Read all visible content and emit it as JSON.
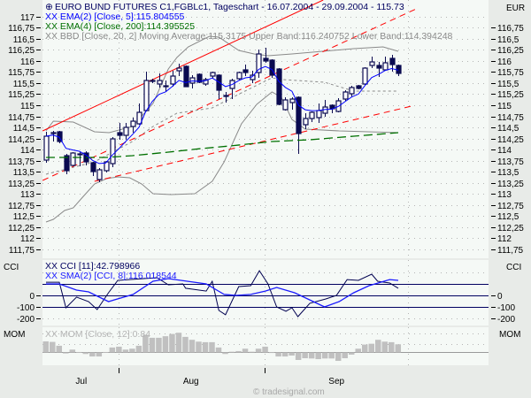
{
  "header": {
    "title": "EURO BUND FUTURES C1,FGBLc1, Tageschart - 16.07.2004 - 29.09.2004 - 115.73",
    "currency": "EUR",
    "legend": [
      {
        "text": "XX EMA(2) [Close, 5]:115.804555",
        "color": "#0000ff"
      },
      {
        "text": "XX EMA(4) [Close, 200]:114.395525",
        "color": "#007000"
      },
      {
        "text": "XX BBD [Close, 20, 2] Moving Average:115.3175 Upper Band:116.240752 Lower Band:114.394248",
        "color": "#8a8a8a"
      }
    ]
  },
  "cci_panel": {
    "label": "CCI",
    "legend": [
      {
        "text": "XX CCI [11]:42.798966",
        "color": "#000060"
      },
      {
        "text": "XX SMA(2) [CCI, 8]:116.018544",
        "color": "#1a1aff"
      }
    ]
  },
  "mom_panel": {
    "label": "MOM",
    "legend": {
      "text": "XX MOM [Close, 12]:0.84",
      "color": "#b4b4b4"
    }
  },
  "footer": {
    "copyright": "© tradesignal.com"
  },
  "colors": {
    "background": "#e8ebe8",
    "plot": "#f5f9f6",
    "candle": "#0a0a50",
    "ema5": "#0000ff",
    "ema200": "#007000",
    "bands": "#8a8a8a",
    "trend": "#ff0000",
    "mom": "#c0c0c0"
  },
  "chart_data": [
    {
      "type": "candlestick",
      "title": "EURO BUND FUTURES C1,FGBLc1, Tageschart - 16.07.2004 - 29.09.2004 - 115.73",
      "ylabel": "EUR",
      "ylim": [
        111.54,
        117.38
      ],
      "y_ticks_left": [
        "117",
        "116,75",
        "116,5",
        "116,25",
        "116",
        "115,75",
        "115,5",
        "115,25",
        "115",
        "114,75",
        "114,5",
        "114,25",
        "114",
        "113,75",
        "113,5",
        "113,25",
        "113",
        "112,75",
        "112,5",
        "112,25",
        "112",
        "111,75"
      ],
      "y_ticks_right": [
        "116,75",
        "116,5",
        "116,25",
        "116",
        "115,75",
        "115,5",
        "115,25",
        "115",
        "114,75",
        "114,5",
        "114,25",
        "114",
        "113,75",
        "113,5",
        "113,25",
        "113",
        "112,75",
        "112,5",
        "112,25",
        "112",
        "111,75"
      ],
      "x_labels": [
        {
          "label": "Jul",
          "index": 5.3
        },
        {
          "label": "Aug",
          "index": 21.8
        },
        {
          "label": "Sep",
          "index": 43.7
        }
      ],
      "month_boundaries": [
        10.9,
        32.9
      ],
      "ohlc": [
        [
          113.76,
          114.4,
          113.7,
          114.3
        ],
        [
          114.37,
          114.42,
          114.18,
          114.38
        ],
        [
          114.4,
          114.42,
          114.14,
          114.18
        ],
        [
          113.86,
          113.9,
          113.44,
          113.52
        ],
        [
          113.64,
          113.94,
          113.62,
          113.92
        ],
        [
          113.88,
          113.94,
          113.62,
          113.9
        ],
        [
          113.92,
          113.96,
          113.64,
          113.72
        ],
        [
          113.7,
          113.72,
          113.4,
          113.5
        ],
        [
          113.32,
          113.58,
          113.26,
          113.54
        ],
        [
          113.52,
          113.74,
          113.48,
          113.72
        ],
        [
          113.68,
          114.28,
          113.6,
          114.24
        ],
        [
          114.38,
          114.6,
          114.22,
          114.32
        ],
        [
          114.32,
          114.6,
          114.22,
          114.5
        ],
        [
          114.52,
          114.72,
          114.38,
          114.64
        ],
        [
          114.58,
          115.04,
          114.56,
          114.84
        ],
        [
          114.88,
          115.76,
          114.86,
          115.56
        ],
        [
          115.54,
          115.6,
          115.5,
          115.56
        ],
        [
          115.48,
          115.72,
          115.4,
          115.56
        ],
        [
          115.44,
          115.56,
          115.3,
          115.42
        ],
        [
          115.48,
          115.78,
          115.42,
          115.66
        ],
        [
          115.78,
          115.94,
          115.66,
          115.84
        ],
        [
          115.88,
          115.9,
          115.42,
          115.42
        ],
        [
          115.5,
          115.68,
          115.38,
          115.62
        ],
        [
          115.7,
          115.72,
          115.5,
          115.52
        ],
        [
          115.48,
          115.62,
          115.44,
          115.58
        ],
        [
          115.66,
          115.76,
          115.6,
          115.74
        ],
        [
          115.68,
          115.7,
          115.14,
          115.34
        ],
        [
          115.2,
          115.3,
          115.06,
          115.22
        ],
        [
          115.38,
          115.6,
          115.14,
          115.56
        ],
        [
          115.6,
          115.76,
          115.56,
          115.74
        ],
        [
          115.8,
          115.92,
          115.66,
          115.74
        ],
        [
          115.58,
          115.78,
          115.5,
          115.68
        ],
        [
          115.74,
          116.26,
          115.62,
          116.16
        ],
        [
          116.06,
          116.3,
          115.96,
          116.0
        ],
        [
          116.02,
          116.04,
          115.62,
          115.68
        ],
        [
          115.82,
          115.84,
          115.0,
          115.02
        ],
        [
          114.9,
          115.18,
          114.88,
          115.12
        ],
        [
          115.06,
          115.18,
          114.9,
          115.14
        ],
        [
          115.18,
          115.2,
          113.9,
          114.36
        ],
        [
          114.56,
          114.82,
          114.46,
          114.7
        ],
        [
          114.7,
          114.86,
          114.62,
          114.84
        ],
        [
          114.72,
          115.04,
          114.6,
          114.88
        ],
        [
          114.82,
          115.12,
          114.74,
          114.96
        ],
        [
          115.0,
          115.02,
          114.82,
          114.92
        ],
        [
          114.86,
          115.16,
          114.84,
          115.1
        ],
        [
          115.14,
          115.34,
          115.1,
          115.3
        ],
        [
          115.26,
          115.44,
          115.2,
          115.4
        ],
        [
          115.44,
          115.46,
          115.36,
          115.38
        ],
        [
          115.48,
          115.86,
          115.46,
          115.84
        ],
        [
          115.9,
          116.1,
          115.84,
          115.98
        ],
        [
          115.9,
          115.98,
          115.64,
          115.84
        ],
        [
          115.8,
          116.1,
          115.78,
          115.96
        ],
        [
          116.06,
          116.14,
          115.76,
          115.92
        ],
        [
          115.9,
          115.92,
          115.66,
          115.72
        ]
      ],
      "ema200": [
        [
          0,
          113.82
        ],
        [
          9,
          113.82
        ],
        [
          13,
          113.86
        ],
        [
          18.4,
          113.94
        ],
        [
          23.3,
          114.02
        ],
        [
          27.7,
          114.08
        ],
        [
          34,
          114.18
        ],
        [
          39.7,
          114.22
        ],
        [
          46.3,
          114.3
        ],
        [
          53,
          114.38
        ]
      ],
      "bb_upper": [
        [
          0,
          114.42
        ],
        [
          1.1,
          114.64
        ],
        [
          4.1,
          114.62
        ],
        [
          7.3,
          114.4
        ],
        [
          9.5,
          114.38
        ],
        [
          13,
          114.52
        ],
        [
          16.1,
          115.04
        ],
        [
          18.4,
          115.82
        ],
        [
          19.7,
          116.08
        ],
        [
          21.4,
          116.32
        ],
        [
          24.6,
          116.56
        ],
        [
          26,
          116.54
        ],
        [
          29,
          116.24
        ],
        [
          31.3,
          116.16
        ],
        [
          33.4,
          116.12
        ],
        [
          37,
          116.16
        ],
        [
          46.3,
          116.28
        ],
        [
          50.7,
          116.32
        ],
        [
          53,
          116.22
        ]
      ],
      "bb_middle": [
        [
          0,
          113.44
        ],
        [
          7.3,
          113.72
        ],
        [
          13,
          114.18
        ],
        [
          16.1,
          114.52
        ],
        [
          19.7,
          114.82
        ],
        [
          25,
          114.94
        ],
        [
          29.4,
          115.28
        ],
        [
          34,
          115.62
        ],
        [
          35.7,
          115.58
        ],
        [
          41.9,
          115.52
        ],
        [
          46.3,
          115.32
        ],
        [
          53,
          115.32
        ]
      ],
      "bb_lower": [
        [
          0,
          112.36
        ],
        [
          1.1,
          112.42
        ],
        [
          2.8,
          112.62
        ],
        [
          4.1,
          112.68
        ],
        [
          5.5,
          112.92
        ],
        [
          7.3,
          113.22
        ],
        [
          9.1,
          113.34
        ],
        [
          10.8,
          113.38
        ],
        [
          12.6,
          113.36
        ],
        [
          14.4,
          113.22
        ],
        [
          16.1,
          113.0
        ],
        [
          18.8,
          112.98
        ],
        [
          22.4,
          113.0
        ],
        [
          25,
          113.28
        ],
        [
          26.8,
          113.72
        ],
        [
          29.4,
          114.58
        ],
        [
          31.7,
          115.02
        ],
        [
          34,
          115.3
        ],
        [
          35.4,
          115.18
        ],
        [
          37,
          114.68
        ],
        [
          39,
          114.46
        ],
        [
          44.1,
          114.42
        ],
        [
          53,
          114.38
        ]
      ],
      "trendlines": [
        {
          "name": "upper-channel",
          "style": "solid",
          "points": [
            [
              -0.5,
              114.42
            ],
            [
              41.7,
              117.38
            ]
          ]
        },
        {
          "name": "middle-channel",
          "style": "dashed",
          "points": [
            [
              -0.5,
              113.3
            ],
            [
              55.7,
              117.18
            ]
          ]
        },
        {
          "name": "lower-channel",
          "style": "dashed",
          "points": [
            [
              7.3,
              113.28
            ],
            [
              55,
              114.98
            ]
          ]
        }
      ]
    },
    {
      "type": "line",
      "title": "CCI",
      "ylim": [
        -262,
        308
      ],
      "y_ticks": [
        "0",
        "-100",
        "-200"
      ],
      "levels": [
        100,
        0,
        -100
      ],
      "cci": [
        [
          0,
          115
        ],
        [
          2,
          115
        ],
        [
          3,
          -108
        ],
        [
          4.6,
          -15
        ],
        [
          6.4,
          -54
        ],
        [
          7.7,
          -123
        ],
        [
          9.4,
          23
        ],
        [
          10.8,
          131
        ],
        [
          16.7,
          154
        ],
        [
          18.4,
          92
        ],
        [
          20.6,
          100
        ],
        [
          21,
          62
        ],
        [
          24.1,
          38
        ],
        [
          25,
          123
        ],
        [
          26,
          -131
        ],
        [
          27,
          -169
        ],
        [
          29,
          77
        ],
        [
          30.8,
          85
        ],
        [
          32.1,
          215
        ],
        [
          33.4,
          100
        ],
        [
          34.7,
          -100
        ],
        [
          36.1,
          -138
        ],
        [
          37,
          -108
        ],
        [
          37.9,
          -185
        ],
        [
          39.7,
          -69
        ],
        [
          42.1,
          -31
        ],
        [
          43.7,
          0
        ],
        [
          45.3,
          138
        ],
        [
          47,
          131
        ],
        [
          49,
          185
        ],
        [
          49.9,
          123
        ],
        [
          51.7,
          108
        ],
        [
          53,
          62
        ]
      ],
      "sma": [
        [
          0,
          100
        ],
        [
          2,
          100
        ],
        [
          4.6,
          46
        ],
        [
          6.4,
          31
        ],
        [
          9.4,
          -54
        ],
        [
          13.1,
          8
        ],
        [
          16.1,
          123
        ],
        [
          18.4,
          146
        ],
        [
          24.1,
          100
        ],
        [
          26.8,
          8
        ],
        [
          28.6,
          0
        ],
        [
          30.8,
          8
        ],
        [
          33,
          38
        ],
        [
          34.7,
          69
        ],
        [
          37.4,
          23
        ],
        [
          41.9,
          -100
        ],
        [
          44.1,
          -54
        ],
        [
          46.3,
          23
        ],
        [
          48.6,
          85
        ],
        [
          51.7,
          138
        ],
        [
          53,
          131
        ]
      ]
    },
    {
      "type": "bar",
      "title": "MOM",
      "ylim": [
        -1.45,
        2.7
      ],
      "values": [
        1.16,
        1.1,
        0.68,
        -0.16,
        0.26,
        0,
        -0.22,
        -0.49,
        -0.49,
        0,
        0.49,
        0.58,
        0.26,
        0.36,
        0.68,
        1.87,
        1.55,
        1.55,
        1.72,
        1.97,
        2.1,
        1.65,
        1.33,
        1.13,
        1.07,
        1.07,
        0.49,
        -0.22,
        0.03,
        0.1,
        0.36,
        0.03,
        0.36,
        0.58,
        -0.03,
        -0.49,
        -0.49,
        -0.39,
        -0.87,
        -0.68,
        -0.71,
        -0.78,
        -0.71,
        -0.71,
        -0.97,
        -0.68,
        -0.29,
        0.36,
        0.81,
        0.9,
        1.33,
        1.13,
        1.07,
        0.84
      ]
    }
  ]
}
